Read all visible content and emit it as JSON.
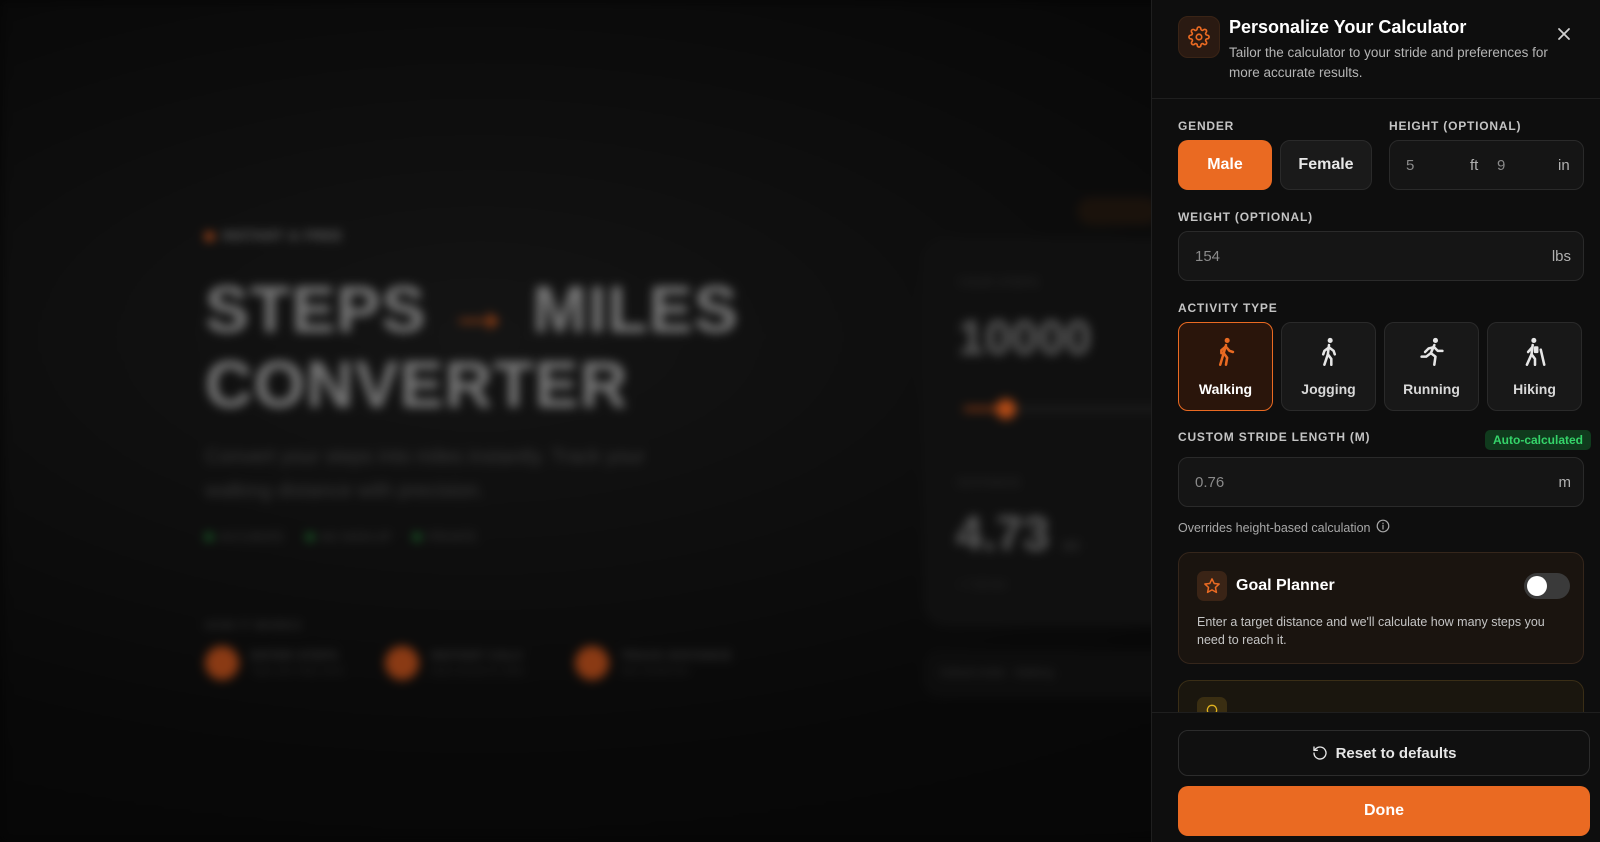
{
  "background": {
    "badge": "INSTANT & FREE",
    "hero_line1_a": "STEPS",
    "hero_arrow": "→",
    "hero_line1_b": "MILES",
    "hero_line2": "CONVERTER",
    "subtitle": "Convert your steps into miles instantly. Track your walking distance with precision.",
    "chips": [
      "ACCURATE",
      "NO SIGN-UP",
      "PRIVATE"
    ],
    "how_label": "HOW IT WORKS",
    "features": [
      {
        "title": "ENTER STEPS",
        "sub": "Type your step count"
      },
      {
        "title": "INSTANT CALC",
        "sub": "Auto-convert to miles"
      },
      {
        "title": "TRACK DISTANCE",
        "sub": "See results live"
      }
    ],
    "card": {
      "steps_label": "YOUR STEPS",
      "steps_value": "10000",
      "distance_label": "DISTANCE",
      "distance_value": "4.73",
      "distance_unit": "mi",
      "footnote": "≈ 7.62 km"
    },
    "bottom_bar": "Default stride · Walking"
  },
  "panel": {
    "title": "Personalize Your Calculator",
    "subtitle": "Tailor the calculator to your stride and preferences for more accurate results.",
    "gender": {
      "label": "GENDER",
      "options": [
        "Male",
        "Female"
      ],
      "selected": "Male"
    },
    "height": {
      "label": "HEIGHT (OPTIONAL)",
      "ft_placeholder": "5",
      "ft_unit": "ft",
      "in_placeholder": "9",
      "in_unit": "in"
    },
    "weight": {
      "label": "WEIGHT (OPTIONAL)",
      "placeholder": "154",
      "unit": "lbs"
    },
    "activity": {
      "label": "ACTIVITY TYPE",
      "options": [
        "Walking",
        "Jogging",
        "Running",
        "Hiking"
      ],
      "selected": "Walking"
    },
    "stride": {
      "label": "CUSTOM STRIDE LENGTH (M)",
      "badge": "Auto-calculated",
      "placeholder": "0.76",
      "unit": "m",
      "hint": "Overrides height-based calculation"
    },
    "goal_planner": {
      "title": "Goal Planner",
      "enabled": false,
      "description": "Enter a target distance and we'll calculate how many steps you need to reach it."
    },
    "footer": {
      "reset_label": "Reset to defaults",
      "done_label": "Done"
    },
    "colors": {
      "accent": "#ea6a22",
      "panel_bg": "#0e0e0e",
      "success": "#35d46a"
    }
  }
}
